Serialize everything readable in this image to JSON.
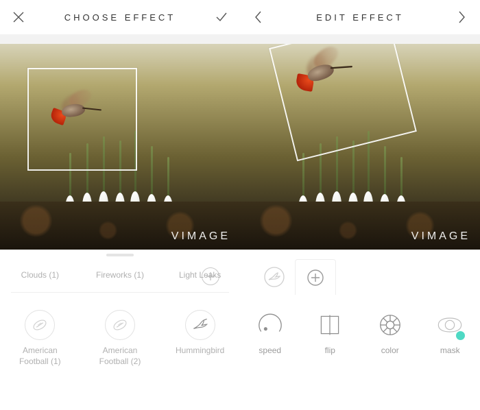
{
  "left": {
    "title": "CHOOSE EFFECT",
    "watermark": "VIMAGE",
    "row_a": [
      {
        "label": "Clouds (1)"
      },
      {
        "label": "Fireworks (1)"
      },
      {
        "label": "Light Leaks"
      }
    ],
    "row_b": [
      {
        "label": "American Football (1)",
        "icon": "football"
      },
      {
        "label": "American Football (2)",
        "icon": "football"
      },
      {
        "label": "Hummingbird",
        "icon": "hummingbird"
      }
    ]
  },
  "right": {
    "title": "EDIT EFFECT",
    "watermark": "VIMAGE",
    "tools": [
      {
        "label": "speed",
        "icon": "speed"
      },
      {
        "label": "flip",
        "icon": "flip"
      },
      {
        "label": "color",
        "icon": "color"
      },
      {
        "label": "mask",
        "icon": "mask"
      }
    ]
  }
}
